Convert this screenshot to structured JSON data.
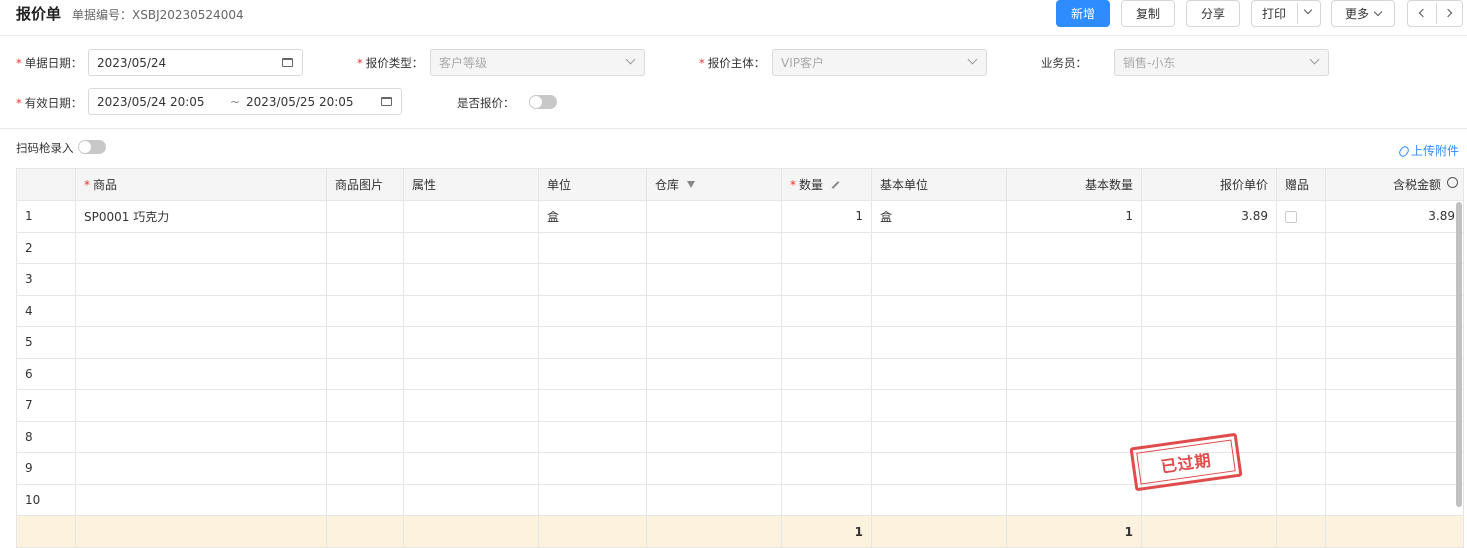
{
  "header": {
    "title": "报价单",
    "doc_no": "单据编号：XSBJ20230524004",
    "buttons": {
      "new": "新增",
      "copy": "复制",
      "share": "分享",
      "print": "打印",
      "more": "更多"
    }
  },
  "form": {
    "doc_date": {
      "label": "单据日期：",
      "value": "2023/05/24"
    },
    "quote_type": {
      "label": "报价类型：",
      "value": "客户等级"
    },
    "quote_subject": {
      "label": "报价主体：",
      "value": "VIP客户"
    },
    "salesman": {
      "label": "业务员：",
      "value": "销售-小东"
    },
    "valid_date": {
      "label": "有效日期：",
      "from": "2023/05/24 20:05",
      "sep": "~",
      "to": "2023/05/25 20:05"
    },
    "is_quoted": {
      "label": "是否报价：",
      "on": false
    }
  },
  "scan": {
    "label": "扫码枪录入",
    "on": false
  },
  "upload": {
    "label": "上传附件"
  },
  "table": {
    "headers": [
      "",
      "商品",
      "商品图片",
      "属性",
      "单位",
      "仓库",
      "数量",
      "基本单位",
      "基本数量",
      "报价单价",
      "赠品",
      "含税金额"
    ],
    "rows": [
      {
        "no": "1",
        "product": "SP0001 巧克力",
        "image": "",
        "attr": "",
        "unit": "盒",
        "warehouse": "",
        "qty": "1",
        "base_unit": "盒",
        "base_qty": "1",
        "price": "3.89",
        "gift": false,
        "amount": "3.89"
      },
      {
        "no": "2",
        "product": "",
        "image": "",
        "attr": "",
        "unit": "",
        "warehouse": "",
        "qty": "",
        "base_unit": "",
        "base_qty": "",
        "price": "",
        "gift": null,
        "amount": ""
      },
      {
        "no": "3",
        "product": "",
        "image": "",
        "attr": "",
        "unit": "",
        "warehouse": "",
        "qty": "",
        "base_unit": "",
        "base_qty": "",
        "price": "",
        "gift": null,
        "amount": ""
      },
      {
        "no": "4",
        "product": "",
        "image": "",
        "attr": "",
        "unit": "",
        "warehouse": "",
        "qty": "",
        "base_unit": "",
        "base_qty": "",
        "price": "",
        "gift": null,
        "amount": ""
      },
      {
        "no": "5",
        "product": "",
        "image": "",
        "attr": "",
        "unit": "",
        "warehouse": "",
        "qty": "",
        "base_unit": "",
        "base_qty": "",
        "price": "",
        "gift": null,
        "amount": ""
      },
      {
        "no": "6",
        "product": "",
        "image": "",
        "attr": "",
        "unit": "",
        "warehouse": "",
        "qty": "",
        "base_unit": "",
        "base_qty": "",
        "price": "",
        "gift": null,
        "amount": ""
      },
      {
        "no": "7",
        "product": "",
        "image": "",
        "attr": "",
        "unit": "",
        "warehouse": "",
        "qty": "",
        "base_unit": "",
        "base_qty": "",
        "price": "",
        "gift": null,
        "amount": ""
      },
      {
        "no": "8",
        "product": "",
        "image": "",
        "attr": "",
        "unit": "",
        "warehouse": "",
        "qty": "",
        "base_unit": "",
        "base_qty": "",
        "price": "",
        "gift": null,
        "amount": ""
      },
      {
        "no": "9",
        "product": "",
        "image": "",
        "attr": "",
        "unit": "",
        "warehouse": "",
        "qty": "",
        "base_unit": "",
        "base_qty": "",
        "price": "",
        "gift": null,
        "amount": ""
      },
      {
        "no": "10",
        "product": "",
        "image": "",
        "attr": "",
        "unit": "",
        "warehouse": "",
        "qty": "",
        "base_unit": "",
        "base_qty": "",
        "price": "",
        "gift": null,
        "amount": ""
      }
    ],
    "totals": {
      "qty": "1",
      "base_qty": "1"
    }
  },
  "stamp": {
    "text": "已过期"
  },
  "colors": {
    "primary": "#2f8cff",
    "required": "#e33",
    "stamp": "#e04b4b",
    "total_row": "#fdf2dd"
  }
}
